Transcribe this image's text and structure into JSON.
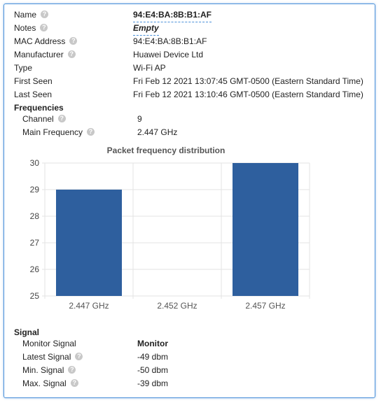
{
  "device": {
    "name_label": "Name",
    "name_value": "94:E4:BA:8B:B1:AF",
    "notes_label": "Notes",
    "notes_value": "Empty",
    "mac_label": "MAC Address",
    "mac_value": "94:E4:BA:8B:B1:AF",
    "manufacturer_label": "Manufacturer",
    "manufacturer_value": "Huawei Device Ltd",
    "type_label": "Type",
    "type_value": "Wi-Fi AP",
    "first_seen_label": "First Seen",
    "first_seen_value": "Fri Feb 12 2021 13:07:45 GMT-0500 (Eastern Standard Time)",
    "last_seen_label": "Last Seen",
    "last_seen_value": "Fri Feb 12 2021 13:10:46 GMT-0500 (Eastern Standard Time)"
  },
  "frequencies": {
    "heading": "Frequencies",
    "channel_label": "Channel",
    "channel_value": "9",
    "main_freq_label": "Main Frequency",
    "main_freq_value": "2.447 GHz"
  },
  "chart_data": {
    "type": "bar",
    "title": "Packet frequency distribution",
    "categories": [
      "2.447 GHz",
      "2.452 GHz",
      "2.457 GHz"
    ],
    "values": [
      29,
      null,
      30
    ],
    "ylim": [
      25,
      30
    ],
    "yticks": [
      25,
      26,
      27,
      28,
      29,
      30
    ],
    "bar_color": "#2e5f9e",
    "grid": true
  },
  "signal": {
    "heading": "Signal",
    "monitor_label": "Monitor Signal",
    "monitor_value": "Monitor",
    "latest_label": "Latest Signal",
    "latest_value": "-49 dbm",
    "min_label": "Min. Signal",
    "min_value": "-50 dbm",
    "max_label": "Max. Signal",
    "max_value": "-39 dbm"
  },
  "help_icon_glyph": "?"
}
